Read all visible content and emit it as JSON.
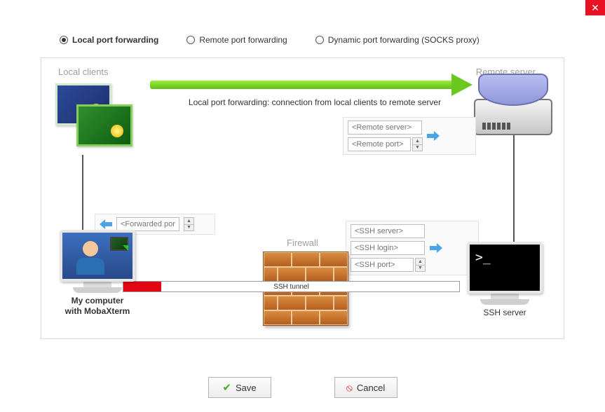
{
  "window": {
    "close": "✕"
  },
  "radios": {
    "local": {
      "label": "Local port forwarding",
      "selected": true
    },
    "remote": {
      "label": "Remote port forwarding",
      "selected": false
    },
    "dynamic": {
      "label": "Dynamic port forwarding (SOCKS proxy)",
      "selected": false
    }
  },
  "diagram": {
    "local_clients_label": "Local clients",
    "remote_server_label": "Remote server",
    "firewall_label": "Firewall",
    "arrow_caption": "Local port forwarding: connection from local clients to remote server",
    "tunnel_label": "SSH tunnel",
    "my_computer_line1": "My computer",
    "my_computer_line2": "with MobaXterm",
    "ssh_server_caption": "SSH server"
  },
  "fields": {
    "remote_server_placeholder": "<Remote server>",
    "remote_port_placeholder": "<Remote port>",
    "forwarded_port_placeholder": "<Forwarded port>",
    "ssh_server_placeholder": "<SSH server>",
    "ssh_login_placeholder": "<SSH login>",
    "ssh_port_placeholder": "<SSH port>"
  },
  "buttons": {
    "save": "Save",
    "cancel": "Cancel"
  }
}
